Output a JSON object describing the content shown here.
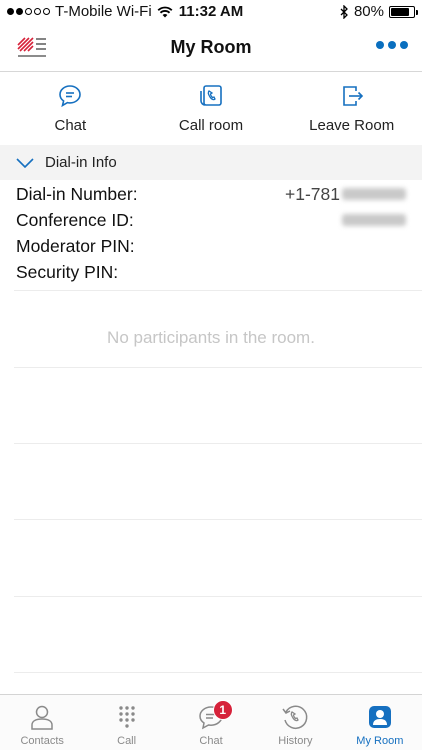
{
  "status_bar": {
    "carrier": "T-Mobile Wi-Fi",
    "time": "11:32 AM",
    "battery": "80%",
    "battery_level": 0.8,
    "signal_filled": 2,
    "signal_total": 5
  },
  "header": {
    "title": "My Room"
  },
  "actions": [
    {
      "label": "Chat",
      "icon": "chat-bubble-icon"
    },
    {
      "label": "Call room",
      "icon": "call-room-icon"
    },
    {
      "label": "Leave Room",
      "icon": "leave-room-icon"
    }
  ],
  "dialin": {
    "section_label": "Dial-in Info",
    "rows": [
      {
        "label": "Dial-in Number:",
        "value": "+1-781"
      },
      {
        "label": "Conference ID:",
        "value": ""
      },
      {
        "label": "Moderator PIN:",
        "value": ""
      },
      {
        "label": "Security PIN:",
        "value": ""
      }
    ]
  },
  "participants": {
    "empty_message": "No participants in the room."
  },
  "tabs": [
    {
      "label": "Contacts",
      "icon": "person-icon",
      "active": false
    },
    {
      "label": "Call",
      "icon": "keypad-icon",
      "active": false
    },
    {
      "label": "Chat",
      "icon": "chat-icon",
      "active": false,
      "badge": "1"
    },
    {
      "label": "History",
      "icon": "history-icon",
      "active": false
    },
    {
      "label": "My Room",
      "icon": "my-room-icon",
      "active": true
    }
  ],
  "colors": {
    "accent": "#1670c0",
    "badge": "#d6223a",
    "logo": "#d6223a"
  }
}
